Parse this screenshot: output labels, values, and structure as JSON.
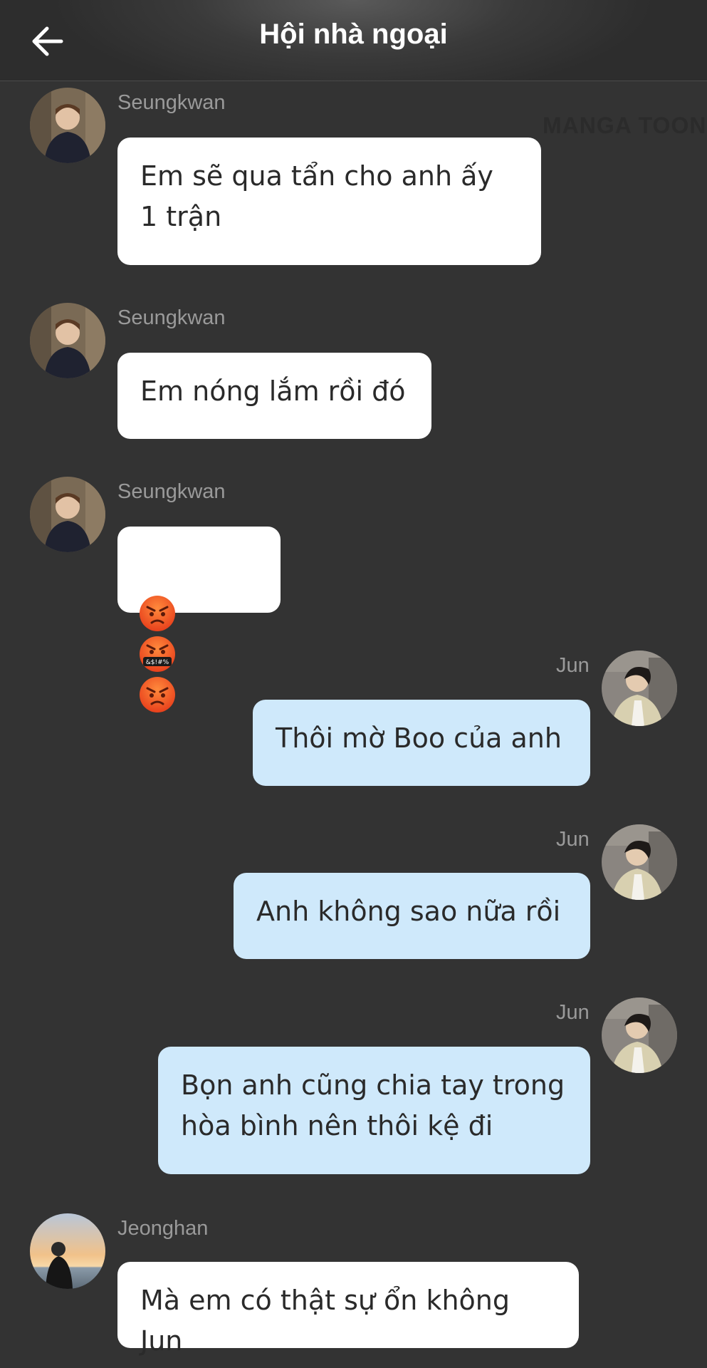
{
  "header": {
    "title": "Hội nhà ngoại"
  },
  "watermark": "MANGA TOON",
  "messages": [
    {
      "sender": "Seungkwan",
      "text": "Em sẽ qua tẩn cho anh ấy\n1 trận"
    },
    {
      "sender": "Seungkwan",
      "text": "Em nóng lắm rồi đó"
    },
    {
      "sender": "Seungkwan",
      "emojis": [
        "angry-face",
        "face-with-symbols-on-mouth",
        "angry-face"
      ]
    },
    {
      "sender": "Jun",
      "text": "Thôi mờ Boo của anh"
    },
    {
      "sender": "Jun",
      "text": "Anh không sao nữa rồi"
    },
    {
      "sender": "Jun",
      "text": "Bọn anh cũng chia tay trong\nhòa bình nên thôi kệ đi"
    },
    {
      "sender": "Jeonghan",
      "text": "Mà em có thật sự ổn không Jun"
    }
  ],
  "emoji_symbols_text": "&$!#%",
  "colors": {
    "background": "#333333",
    "incoming_bubble": "#ffffff",
    "outgoing_bubble": "#cfe9fb",
    "name": "#9a9a9a"
  }
}
